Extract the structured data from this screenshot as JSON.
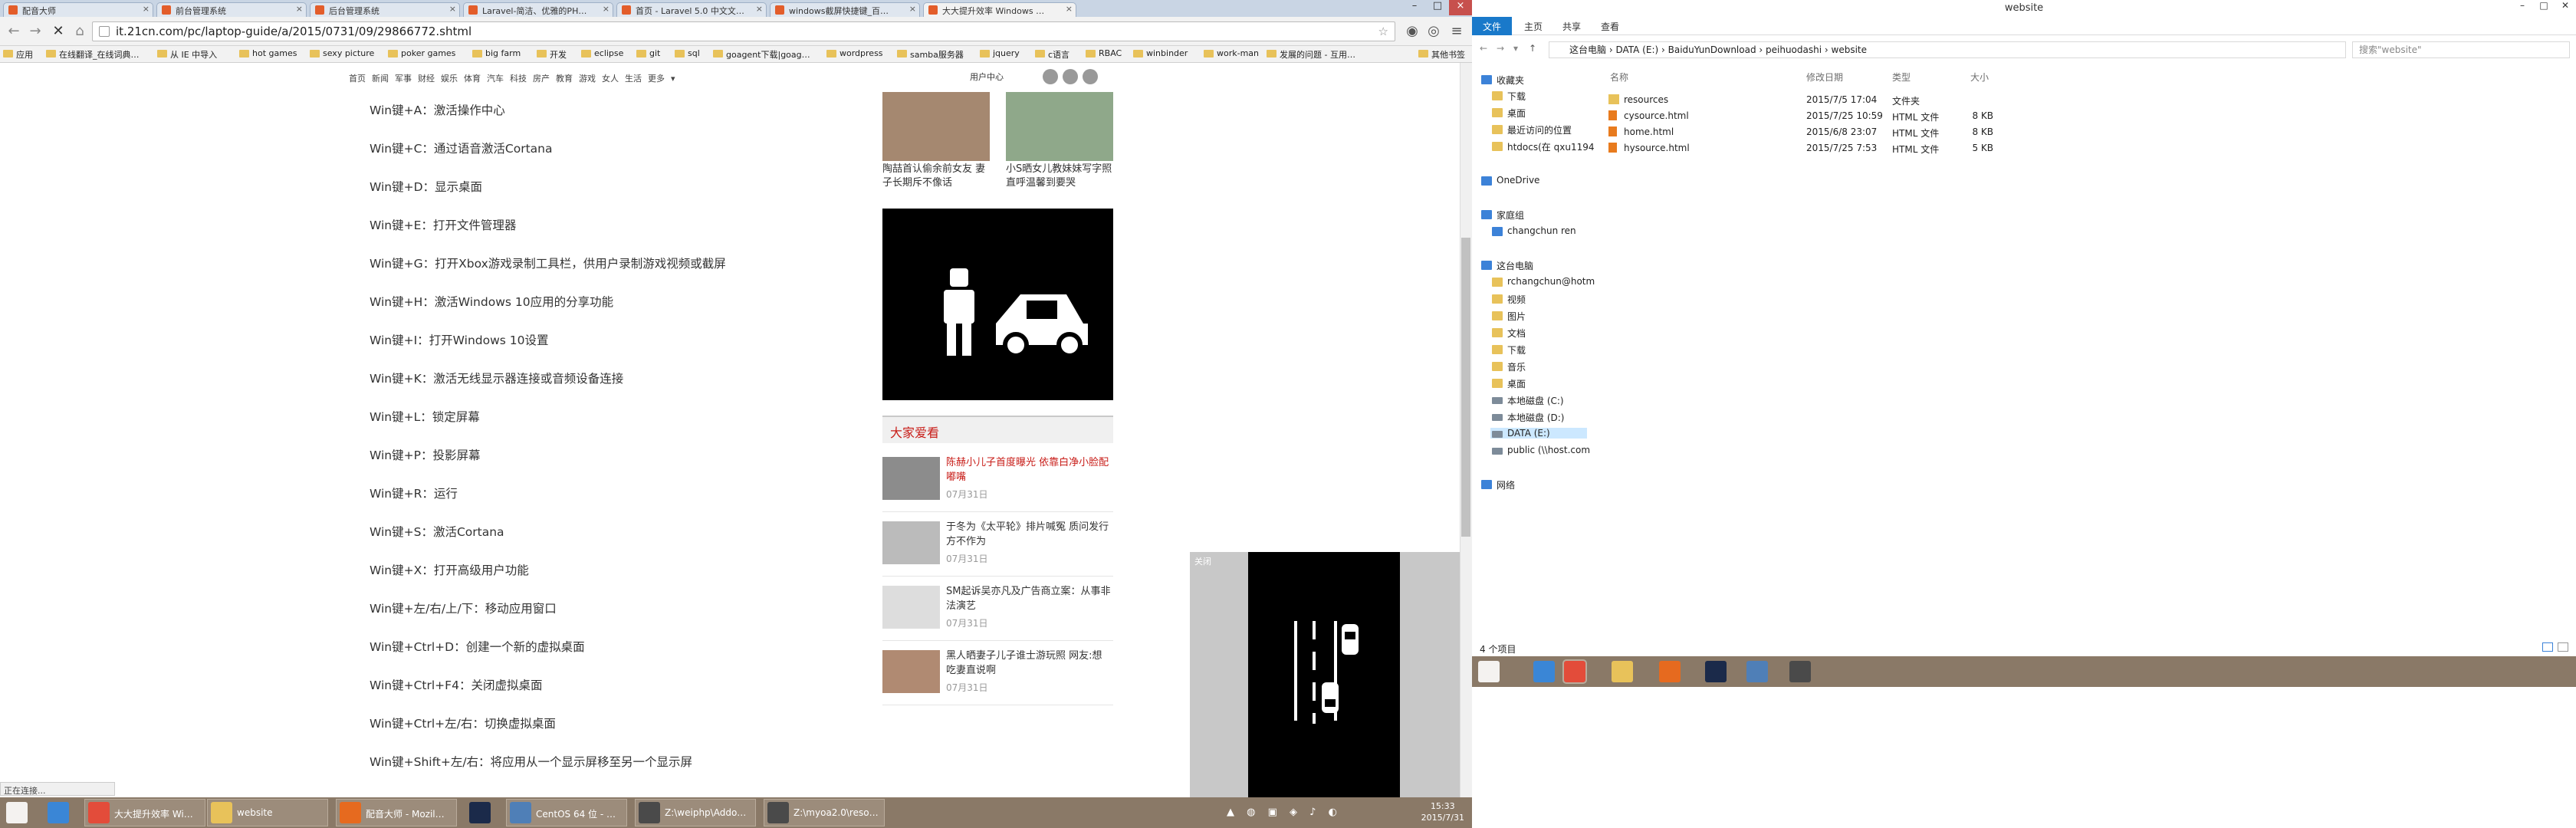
{
  "chrome": {
    "tabs": [
      "配音大师",
      "前台管理系统",
      "后台管理系统",
      "Laravel-简洁、优雅的PH…",
      "首页 - Laravel 5.0 中文文…",
      "windows截屏快捷键_百…",
      "大大提升效率 Windows …"
    ],
    "url": "it.21cn.com/pc/laptop-guide/a/2015/0731/09/29866772.shtml",
    "bookmarks": [
      "应用",
      "在线翻译_在线词典…",
      "从 IE 中导入",
      "hot games",
      "sexy picture",
      "poker games",
      "big farm",
      "开发",
      "eclipse",
      "git",
      "sql",
      "goagent下载|goag…",
      "wordpress",
      "samba服务器",
      "jquery",
      "c语言",
      "RBAC",
      "winbinder",
      "work-man",
      "发展的问题 - 互用…",
      "其他书签"
    ]
  },
  "site": {
    "nav": [
      "首页",
      "新闻",
      "军事",
      "财经",
      "娱乐",
      "体育",
      "汽车",
      "科技",
      "房产",
      "教育",
      "游戏",
      "女人",
      "生活",
      "更多"
    ],
    "user_center": "用户中心"
  },
  "article": [
    "Win键+A：激活操作中心",
    "Win键+C：通过语音激活Cortana",
    "Win键+D：显示桌面",
    "Win键+E：打开文件管理器",
    "Win键+G：打开Xbox游戏录制工具栏，供用户录制游戏视频或截屏",
    "Win键+H：激活Windows 10应用的分享功能",
    "Win键+I：打开Windows 10设置",
    "Win键+K：激活无线显示器连接或音频设备连接",
    "Win键+L：锁定屏幕",
    "Win键+P：投影屏幕",
    "Win键+R：运行",
    "Win键+S：激活Cortana",
    "Win键+X：打开高级用户功能",
    "Win键+左/右/上/下：移动应用窗口",
    "Win键+Ctrl+D：创建一个新的虚拟桌面",
    "Win键+Ctrl+F4：关闭虚拟桌面",
    "Win键+Ctrl+左/右：切换虚拟桌面",
    "Win键+Shift+左/右：将应用从一个显示屏移至另一个显示屏"
  ],
  "sidebar": {
    "top_captions": [
      "陶喆首认偷余前女友 妻子长期斥不像话",
      "小S晒女儿教妹妹写字照 直呼温馨到要哭"
    ],
    "hot_title": "大家爱看",
    "hot": [
      {
        "title": "陈赫小儿子首度曝光 依靠白净小脸配嘟嘴",
        "date": "07月31日",
        "red": true
      },
      {
        "title": "于冬为《太平轮》排片喊冤 质问发行方不作为",
        "date": "07月31日",
        "red": false
      },
      {
        "title": "SM起诉吴亦凡及广告商立案：从事非法演艺",
        "date": "07月31日",
        "red": false
      },
      {
        "title": "黑人晒妻子儿子谁士游玩照 网友:想吃妻直说啊",
        "date": "07月31日",
        "red": false
      }
    ]
  },
  "floating_label": "关闭",
  "status_text": "正在连接...",
  "taskbar": {
    "items": [
      "大大提升效率 Wi…",
      "website",
      "配音大师 - Mozil…",
      "CentOS 64 位 - …",
      "Z:\\weiphp\\Addo…",
      "Z:\\myoa2.0\\reso…"
    ],
    "time": "15:33",
    "date": "2015/7/31"
  },
  "explorer": {
    "title": "website",
    "ribbon_tabs": [
      "文件",
      "主页",
      "共享",
      "查看"
    ],
    "path": [
      "这台电脑",
      "DATA (E:)",
      "BaiduYunDownload",
      "peihuodashi",
      "website"
    ],
    "search_placeholder": "搜索\"website\"",
    "columns": [
      "名称",
      "修改日期",
      "类型",
      "大小"
    ],
    "files": [
      {
        "name": "resources",
        "date": "2015/7/5 17:04",
        "type": "文件夹",
        "size": "",
        "kind": "folder"
      },
      {
        "name": "cysource.html",
        "date": "2015/7/25 10:59",
        "type": "HTML 文件",
        "size": "8 KB",
        "kind": "html"
      },
      {
        "name": "home.html",
        "date": "2015/6/8 23:07",
        "type": "HTML 文件",
        "size": "8 KB",
        "kind": "html"
      },
      {
        "name": "hysource.html",
        "date": "2015/7/25 7:53",
        "type": "HTML 文件",
        "size": "5 KB",
        "kind": "html"
      }
    ],
    "nav": {
      "favorites_header": "收藏夹",
      "favorites": [
        "下载",
        "桌面",
        "最近访问的位置",
        "htdocs(在 qxu1194"
      ],
      "onedrive": "OneDrive",
      "homegroup_header": "家庭组",
      "homegroup_user": "changchun ren",
      "pc_header": "这台电脑",
      "pc": [
        "rchangchun@hotm",
        "视频",
        "图片",
        "文档",
        "下载",
        "音乐",
        "桌面"
      ],
      "drives": [
        "本地磁盘 (C:)",
        "本地磁盘 (D:)",
        "DATA (E:)",
        "public (\\\\host.com"
      ],
      "network": "网络"
    },
    "item_count": "4 个项目"
  }
}
